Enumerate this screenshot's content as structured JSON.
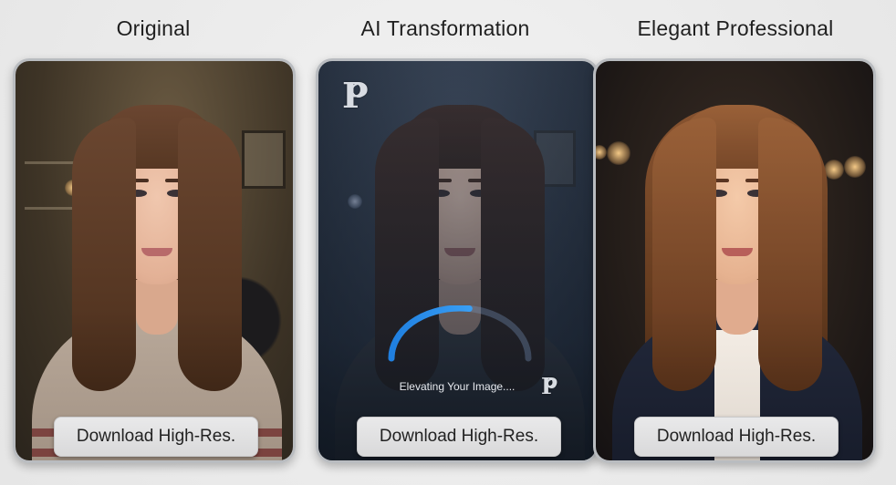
{
  "columns": [
    {
      "title": "Original",
      "button_label": "Download High-Res."
    },
    {
      "title": "AI Transformation",
      "button_label": "Download High-Res."
    },
    {
      "title": "Elegant Professional",
      "button_label": "Download High-Res."
    }
  ],
  "transformation": {
    "status_text": "Elevating Your Image....",
    "progress": 0.55,
    "logo_letter": "P"
  },
  "colors": {
    "background": "#ececec",
    "button_bg": "#e2e2e3",
    "progress_blue": "#2f8fe8",
    "card_border": "#b9bcc0"
  },
  "icons": [
    "logo-p-aperture-icon",
    "progress-arc-icon"
  ]
}
